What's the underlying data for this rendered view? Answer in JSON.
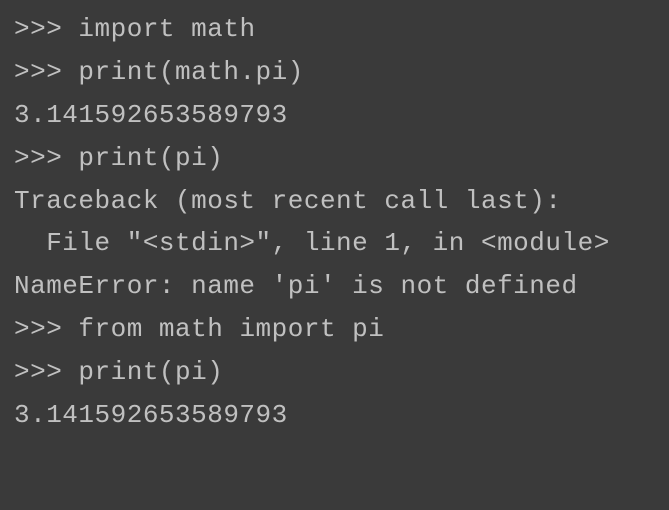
{
  "repl": {
    "prompt": ">>> ",
    "lines": {
      "l1": "import math",
      "l2": "print(math.pi)",
      "l3": "3.141592653589793",
      "l4": "print(pi)",
      "l5": "Traceback (most recent call last):",
      "l6": "  File \"<stdin>\", line 1, in <module>",
      "l7": "NameError: name 'pi' is not defined",
      "l8": "from math import pi",
      "l9": "print(pi)",
      "l10": "3.141592653589793"
    }
  }
}
